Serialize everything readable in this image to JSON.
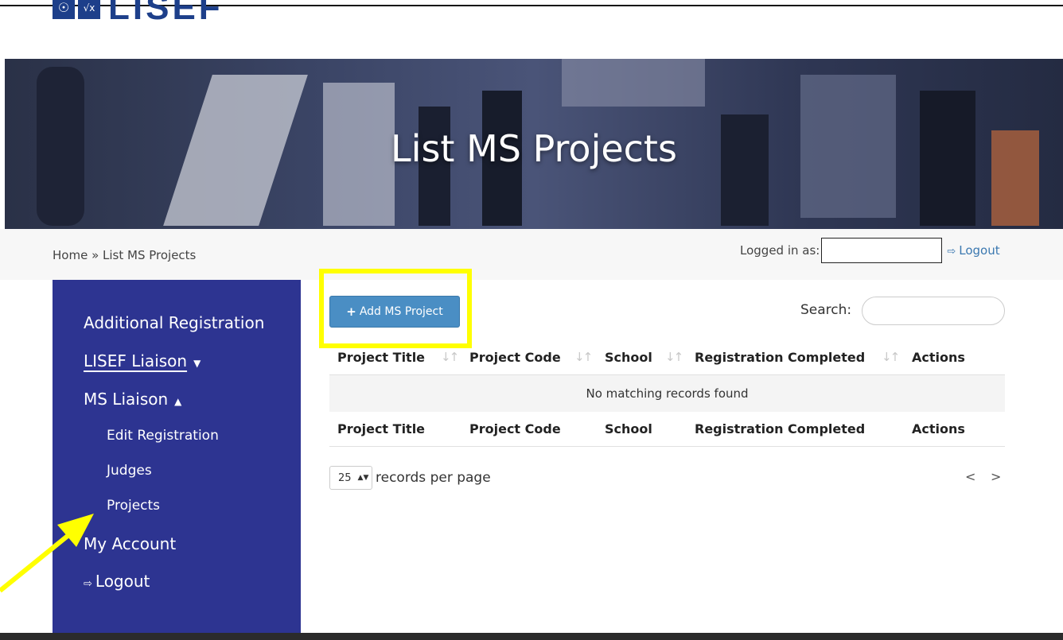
{
  "header": {
    "logo_icon": "globe-sqrt-icon",
    "logo_glyph_1": "☉",
    "logo_glyph_2": "√x",
    "logo_text": "LISEF"
  },
  "banner": {
    "title": "List MS Projects"
  },
  "breadcrumb": {
    "text": "Home » List MS Projects"
  },
  "session": {
    "logged_in_label": "Logged in as:",
    "logout_label": "Logout",
    "logout_icon": "sign-out-icon"
  },
  "sidebar": {
    "items": [
      {
        "label": "Additional Registration"
      },
      {
        "label": "LISEF Liaison",
        "caret": "▼"
      },
      {
        "label": "MS Liaison",
        "caret": "▲"
      },
      {
        "label": "Edit Registration"
      },
      {
        "label": "Judges"
      },
      {
        "label": "Projects"
      },
      {
        "label": "My Account"
      },
      {
        "label": "Logout",
        "icon": "sign-out-icon"
      }
    ]
  },
  "toolbar": {
    "add_label": "Add MS Project",
    "add_icon": "plus-icon",
    "search_label": "Search:"
  },
  "table": {
    "columns": [
      "Project Title",
      "Project Code",
      "School",
      "Registration Completed",
      "Actions"
    ],
    "empty_message": "No matching records found"
  },
  "pager": {
    "page_size": "25",
    "per_page_label": "records per page",
    "prev": "<",
    "next": ">"
  },
  "colors": {
    "sidebar": "#2d3491",
    "accent": "#4a8ec4",
    "highlight": "#ffff00",
    "link": "#3b78b0"
  }
}
